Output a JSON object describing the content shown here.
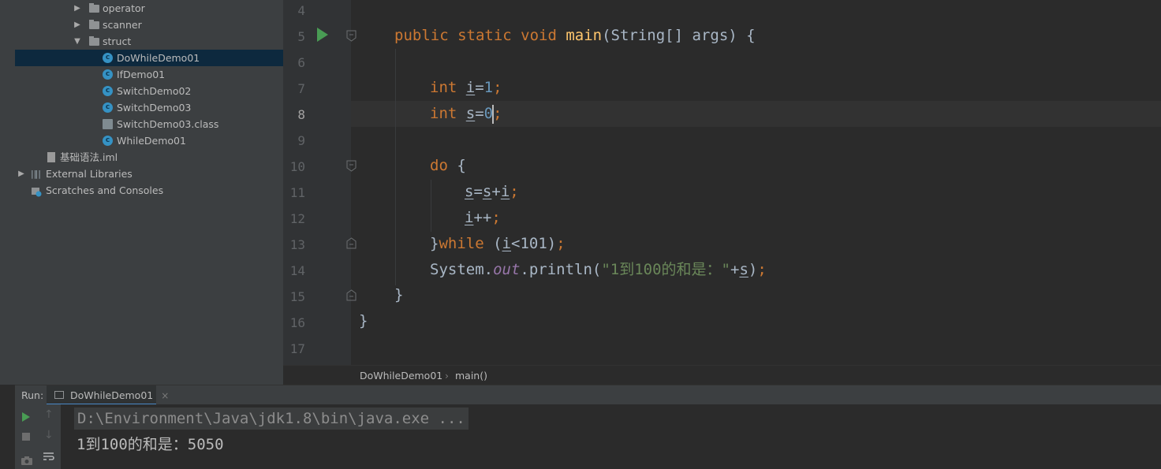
{
  "project_tree": [
    {
      "label": "operator",
      "type": "folder",
      "arrow": "▶",
      "indent": 94
    },
    {
      "label": "scanner",
      "type": "folder",
      "arrow": "▶",
      "indent": 94
    },
    {
      "label": "struct",
      "type": "folder",
      "arrow": "▼",
      "indent": 94
    },
    {
      "label": "DoWhileDemo01",
      "type": "class",
      "indent": 130,
      "selected": true
    },
    {
      "label": "IfDemo01",
      "type": "class",
      "indent": 130
    },
    {
      "label": "SwitchDemo02",
      "type": "class",
      "indent": 130
    },
    {
      "label": "SwitchDemo03",
      "type": "class",
      "indent": 130
    },
    {
      "label": "SwitchDemo03.class",
      "type": "classfile",
      "indent": 130
    },
    {
      "label": "WhileDemo01",
      "type": "class",
      "indent": 130
    },
    {
      "label": "基础语法.iml",
      "type": "file",
      "indent": 58
    },
    {
      "label": "External Libraries",
      "type": "library",
      "arrow": "▶",
      "indent": 20
    },
    {
      "label": "Scratches and Consoles",
      "type": "scratches",
      "indent": 20
    }
  ],
  "editor": {
    "line_numbers": [
      "4",
      "5",
      "6",
      "7",
      "8",
      "9",
      "10",
      "11",
      "12",
      "13",
      "14",
      "15",
      "16",
      "17"
    ],
    "current_line": "8",
    "code": {
      "l5": {
        "kw1": "public static void ",
        "method": "main",
        "rest": "(String[] args) {"
      },
      "l7": {
        "kw": "int ",
        "var": "i",
        "op": "=",
        "num": "1",
        "semi": ";"
      },
      "l8": {
        "kw": "int ",
        "var": "s",
        "op": "=",
        "num": "0",
        "semi": ";"
      },
      "l10": {
        "kw": "do ",
        "brace": "{"
      },
      "l11": {
        "v1": "s",
        "op1": "=",
        "v2": "s",
        "op2": "+",
        "v3": "i",
        "semi": ";"
      },
      "l12": {
        "var": "i",
        "op": "++",
        "semi": ";"
      },
      "l13": {
        "brace": "}",
        "kw": "while ",
        "open": "(",
        "var": "i",
        "rest": "<101)",
        "semi": ";"
      },
      "l14": {
        "cls": "System.",
        "fld": "out",
        "call": ".println(",
        "str": "\"1到100的和是：\"",
        "plus": "+",
        "var": "s",
        "close": ")",
        "semi": ";"
      },
      "l15": {
        "brace": "}"
      },
      "l16": {
        "brace": "}"
      }
    }
  },
  "breadcrumb": {
    "class": "DoWhileDemo01",
    "sep": "›",
    "method": "main()"
  },
  "run_panel": {
    "label": "Run:",
    "tab": "DoWhileDemo01",
    "close": "×",
    "command": "D:\\Environment\\Java\\jdk1.8\\bin\\java.exe ...",
    "output": "1到100的和是：5050"
  }
}
